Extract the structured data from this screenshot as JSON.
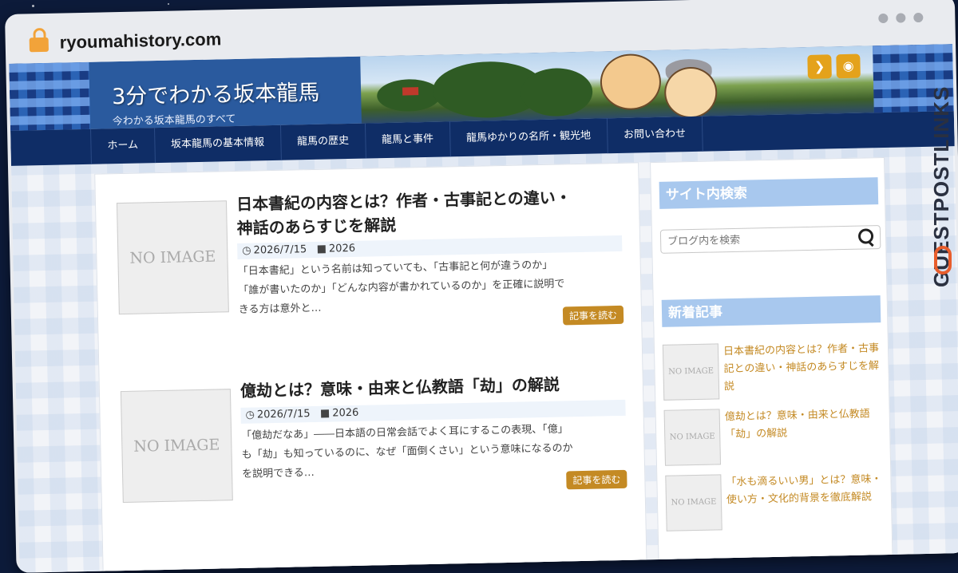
{
  "browser": {
    "url": "ryoumahistory.com"
  },
  "header": {
    "site_title": "3分でわかる坂本龍馬",
    "site_subtitle": "今わかる坂本龍馬のすべて"
  },
  "nav": {
    "items": [
      "ホーム",
      "坂本龍馬の基本情報",
      "龍馬の歴史",
      "龍馬と事件",
      "龍馬ゆかりの名所・観光地",
      "お問い合わせ"
    ]
  },
  "posts": [
    {
      "thumb": "NO IMAGE",
      "title_line1": "日本書紀の内容とは？作者・古事記との違い・",
      "title_line2": "神話のあらすじを解説",
      "date": "2026/7/15",
      "category": "2026",
      "excerpt_line1": "「日本書紀」という名前は知っていても、「古事記と何が違うのか」",
      "excerpt_line2": "「誰が書いたのか」「どんな内容が書かれているのか」を正確に説明で",
      "excerpt_line3": "きる方は意外と…",
      "read_more": "記事を読む"
    },
    {
      "thumb": "NO IMAGE",
      "title_line1": "億劫とは？意味・由来と仏教語「劫」の解説",
      "date": "2026/7/15",
      "category": "2026",
      "excerpt_line1": "「億劫だなあ」――日本語の日常会話でよく耳にするこの表現、「億」",
      "excerpt_line2": "も「劫」も知っているのに、なぜ「面倒くさい」という意味になるのか",
      "excerpt_line3": "を説明できる…",
      "read_more": "記事を読む"
    }
  ],
  "sidebar": {
    "search_title": "サイト内検索",
    "search_placeholder": "ブログ内を検索",
    "recent_title": "新着記事",
    "recent": [
      {
        "thumb": "NO IMAGE",
        "title": "日本書紀の内容とは？作者・古事記との違い・神話のあらすじを解説"
      },
      {
        "thumb": "NO IMAGE",
        "title": "億劫とは？意味・由来と仏教語「劫」の解説"
      },
      {
        "thumb": "NO IMAGE",
        "title": "「水も滴るいい男」とは？意味・使い方・文化的背景を徹底解説"
      }
    ]
  },
  "watermark": "GUESTPOSTLINKS",
  "colors": {
    "nav_bg": "#0f2d66",
    "accent_gold": "#c48a24",
    "widget_title_bg": "#a8c8ee"
  }
}
